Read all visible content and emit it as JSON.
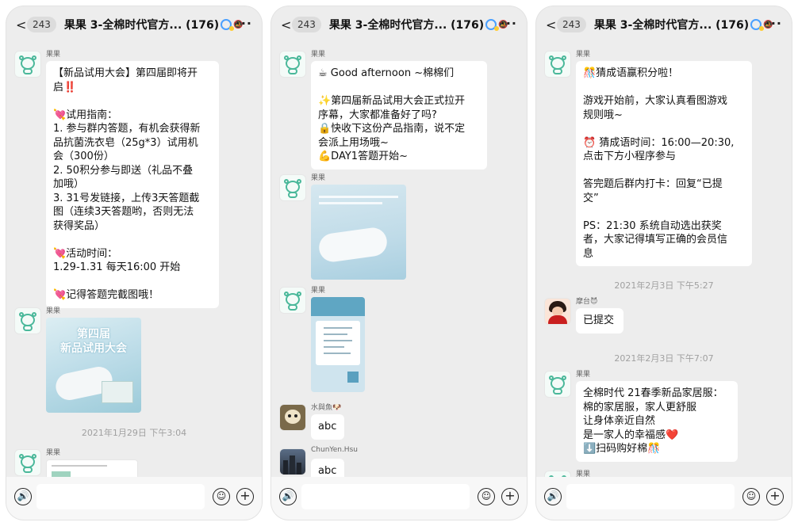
{
  "screens": [
    {
      "header": {
        "back": "<",
        "badge": "243",
        "title": "果果 3-全棉时代官方... (176)",
        "more": "···"
      },
      "messages": [
        {
          "sender": "果果",
          "lines": [
            "【新品试用大会】第四届即将开",
            "启‼️",
            "",
            "💘试用指南：",
            "1. 参与群内答题，有机会获得新",
            "品抗菌洗衣皂（25g*3）试用机",
            "会（300份）",
            "2. 50积分参与即送（礼品不叠",
            "加哦）",
            "3. 31号发链接，上传3天答题截",
            "图（连续3天答题哟，否则无法",
            "获得奖品）",
            "",
            "💘活动时间：",
            "1.29-1.31 每天16:00 开始",
            "",
            "💘记得答题完截图哦！"
          ]
        },
        {
          "sender": "果果",
          "image_text": [
            "第四届",
            "新品试用大会"
          ]
        },
        {
          "time": "2021年1月29日 下午3:04"
        },
        {
          "sender": "果果"
        }
      ]
    },
    {
      "header": {
        "back": "<",
        "badge": "243",
        "title": "果果 3-全棉时代官方... (176)",
        "more": "···"
      },
      "messages": [
        {
          "sender": "果果",
          "lines": [
            "☕ Good afternoon ~棉棉们",
            "",
            "✨第四届新品试用大会正式拉开",
            "序幕，大家都准备好了吗?",
            "🔒快收下这份产品指南，说不定",
            "会派上用场哦~",
            "💪DAY1答题开始~"
          ]
        },
        {
          "sender": "果果"
        },
        {
          "sender": "果果"
        },
        {
          "sender": "水與魚🐶",
          "text": "abc"
        },
        {
          "sender": "ChunYen.Hsu",
          "text": "abc"
        }
      ]
    },
    {
      "header": {
        "back": "<",
        "badge": "243",
        "title": "果果 3-全棉时代官方... (176)",
        "more": "···"
      },
      "messages": [
        {
          "sender": "果果",
          "lines": [
            "🎊猜成语赢积分啦！",
            "",
            "游戏开始前，大家认真看图游戏",
            "规则哦~",
            "",
            "⏰ 猜成语时间：16:00—20:30,",
            "点击下方小程序参与",
            "",
            "答完题后群内打卡：回复“已提",
            "交”",
            "",
            "PS：21:30 系统自动选出获奖",
            "者，大家记得填写正确的会员信",
            "息"
          ]
        },
        {
          "time": "2021年2月3日 下午5:27"
        },
        {
          "sender": "摩台😈",
          "text": "已提交"
        },
        {
          "time": "2021年2月3日 下午7:07"
        },
        {
          "sender": "果果",
          "lines": [
            "全棉时代 21春季新品家居服：",
            "棉的家居服，家人更舒服",
            "让身体亲近自然",
            "是一家人的幸福感❤️",
            "⬇️扫码购好棉🎊"
          ]
        },
        {
          "sender": "果果"
        }
      ]
    }
  ],
  "input_bar": {
    "voice_icon": "🔊",
    "emoji_icon": "☺",
    "plus_icon": "+"
  }
}
